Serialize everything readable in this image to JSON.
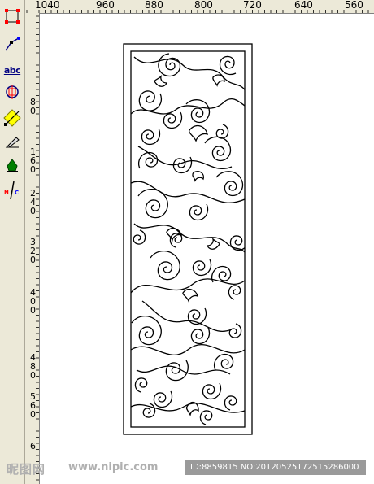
{
  "toolbar": {
    "tools": [
      {
        "icon": "pick-tool-icon"
      },
      {
        "icon": "shape-tool-icon"
      },
      {
        "icon": "text-tool-icon",
        "label": "abc"
      },
      {
        "icon": "contour-tool-icon"
      },
      {
        "icon": "node-edit-tool-icon"
      },
      {
        "icon": "knife-tool-icon"
      },
      {
        "icon": "fill-tool-icon"
      },
      {
        "icon": "nc-tool-icon",
        "label": "NC"
      }
    ],
    "colors": {
      "accent": "#000080",
      "highlight": "#ffff00",
      "fill": "#008000",
      "nc": "#ff0000"
    }
  },
  "ruler": {
    "horizontal_labels": [
      "1040",
      "960",
      "880",
      "800",
      "720",
      "640",
      "560"
    ],
    "vertical_labels": [
      "8\n0",
      "1\n6\n0",
      "2\n4\n0",
      "3\n2\n0",
      "4\n0\n0",
      "4\n8\n0",
      "5\n6\n0",
      "6"
    ]
  },
  "watermark": {
    "logo": "昵图网",
    "site": "www.nipic.com",
    "id_text": "ID:8859815 NO:20120525172515286000"
  }
}
